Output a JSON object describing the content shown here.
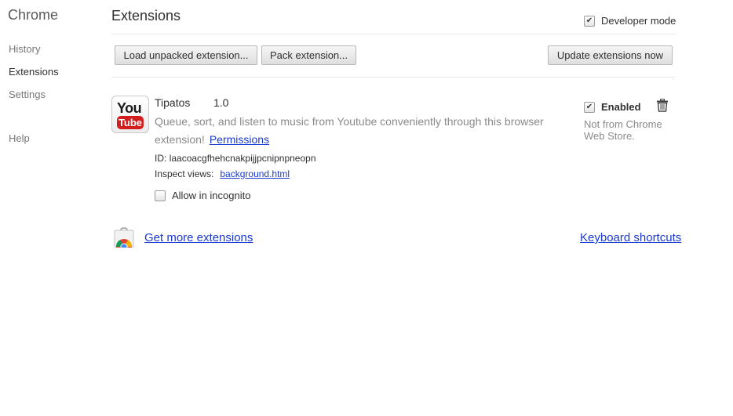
{
  "sidebar": {
    "brand": "Chrome",
    "items": [
      {
        "label": "History"
      },
      {
        "label": "Extensions"
      },
      {
        "label": "Settings"
      },
      {
        "label": "Help"
      }
    ]
  },
  "header": {
    "title": "Extensions",
    "developer_mode_label": "Developer mode",
    "developer_mode_checked": true
  },
  "toolbar": {
    "load_unpacked_label": "Load unpacked extension...",
    "pack_label": "Pack extension...",
    "update_label": "Update extensions now"
  },
  "extension": {
    "name": "Tipatos",
    "version": "1.0",
    "description": "Queue, sort, and listen to music from Youtube conveniently through this browser extension!",
    "permissions_label": "Permissions",
    "id_label": "ID:",
    "id_value": "laacoacgfhehcnakpijjpcnipnpneopn",
    "inspect_label": "Inspect views:",
    "inspect_link": "background.html",
    "incognito_label": "Allow in incognito",
    "incognito_checked": false,
    "enabled_label": "Enabled",
    "enabled_checked": true,
    "store_note": "Not from Chrome Web Store.",
    "icon_text_top": "You",
    "icon_text_bottom": "Tube",
    "icon": "youtube-logo-icon"
  },
  "footer": {
    "get_more_label": "Get more extensions",
    "shortcuts_label": "Keyboard shortcuts",
    "store_icon": "chrome-web-store-icon"
  },
  "colors": {
    "link": "#1a39d0",
    "muted_text": "#8a8a8a",
    "youtube_red": "#d21e1e"
  }
}
